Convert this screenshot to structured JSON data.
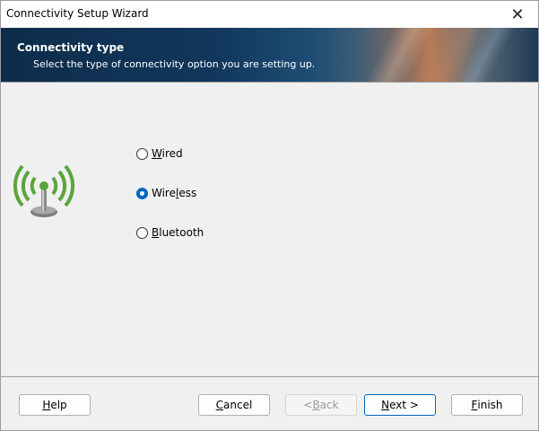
{
  "window": {
    "title": "Connectivity Setup Wizard",
    "close_glyph": "✕"
  },
  "banner": {
    "heading": "Connectivity type",
    "subtitle": "Select the type of connectivity option you are setting up."
  },
  "options": [
    {
      "label_pre": "",
      "label_key": "W",
      "label_post": "ired",
      "checked": false
    },
    {
      "label_pre": "Wire",
      "label_key": "l",
      "label_post": "ess",
      "checked": true
    },
    {
      "label_pre": "",
      "label_key": "B",
      "label_post": "luetooth",
      "checked": false
    }
  ],
  "buttons": {
    "help": {
      "key": "H",
      "rest": "elp"
    },
    "cancel": {
      "key": "C",
      "rest": "ancel"
    },
    "back": {
      "pre": "< ",
      "key": "B",
      "rest": "ack",
      "disabled": true
    },
    "next": {
      "key": "N",
      "rest": "ext >"
    },
    "finish": {
      "key": "F",
      "rest": "inish"
    }
  },
  "colors": {
    "accent": "#0067c0",
    "antenna_green": "#5aa53a",
    "antenna_gray": "#8a8a8a"
  }
}
